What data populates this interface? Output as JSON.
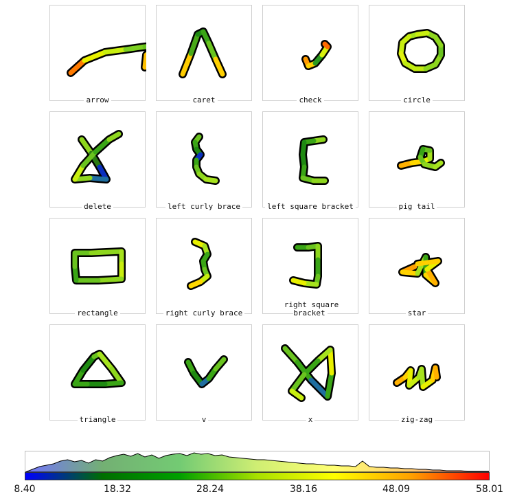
{
  "gestures": [
    {
      "label": "arrow",
      "colors": [
        "#ff7a00",
        "#ffb000",
        "#e8f000",
        "#c8ee10",
        "#9fe020",
        "#7ccf22",
        "#66c01e",
        "#9fe020",
        "#d6ef10",
        "#ffc000"
      ]
    },
    {
      "label": "caret",
      "colors": [
        "#ffcc00",
        "#c8ee10",
        "#4aaa18",
        "#1f8a12",
        "#139012",
        "#3aa516",
        "#6ac31f",
        "#a6e21e",
        "#ffd000"
      ]
    },
    {
      "label": "check",
      "colors": [
        "#ff9900",
        "#ffd200",
        "#2a3fcc",
        "#2a9a20",
        "#d8f010",
        "#ff6a00"
      ]
    },
    {
      "label": "circle",
      "colors": [
        "#a6e21e",
        "#c8ee10",
        "#e0f210",
        "#c0ea12",
        "#8ed61e",
        "#6ac31f",
        "#8ed61e",
        "#c8ee10"
      ]
    },
    {
      "label": "delete",
      "colors": [
        "#8ed61e",
        "#2a7a12",
        "#0a2fbf",
        "#1f6ea0",
        "#3aa516",
        "#8ed61e",
        "#c8ee10",
        "#6ac31f",
        "#3aa516",
        "#8ed61e"
      ]
    },
    {
      "label": "left curly brace",
      "colors": [
        "#6ac31f",
        "#3aa516",
        "#1f8a12",
        "#0a2fbf",
        "#1f8a12",
        "#3aa516",
        "#6ac31f",
        "#8ed61e",
        "#a6e21e"
      ]
    },
    {
      "label": "left square bracket",
      "colors": [
        "#8ed61e",
        "#3aa516",
        "#1f8a12",
        "#0a2fbf",
        "#1f8a12",
        "#3aa516",
        "#6ac31f",
        "#8ed61e"
      ]
    },
    {
      "label": "pig tail",
      "colors": [
        "#ffb000",
        "#ffd800",
        "#e8f000",
        "#a6e21e",
        "#6ac31f",
        "#3aa516",
        "#6ac31f",
        "#8ed61e",
        "#a6e21e"
      ]
    },
    {
      "label": "rectangle",
      "colors": [
        "#6ac31f",
        "#8ed61e",
        "#a6e21e",
        "#c8ee10",
        "#a6e21e",
        "#8ed61e",
        "#6ac31f",
        "#3aa516",
        "#6ac31f"
      ]
    },
    {
      "label": "right curly brace",
      "colors": [
        "#e8f000",
        "#a6e21e",
        "#3aa516",
        "#0a2fbf",
        "#3aa516",
        "#6ac31f",
        "#c8ee10",
        "#ffd800"
      ]
    },
    {
      "label": "right square bracket",
      "colors": [
        "#3aa516",
        "#6ac31f",
        "#8ed61e",
        "#3aa516",
        "#6ac31f",
        "#a6e21e",
        "#e8f000"
      ]
    },
    {
      "label": "star",
      "colors": [
        "#ffa000",
        "#ffd200",
        "#a6e21e",
        "#3aa516",
        "#c8ee10",
        "#ffd800",
        "#ffb000",
        "#e8f000",
        "#ffd000"
      ]
    },
    {
      "label": "triangle",
      "colors": [
        "#3aa516",
        "#1f8a12",
        "#6ac31f",
        "#a6e21e",
        "#8ed61e",
        "#3aa516",
        "#1f8a12",
        "#3aa516"
      ]
    },
    {
      "label": "v",
      "colors": [
        "#3aa516",
        "#1f8a12",
        "#0a2fbf",
        "#1f6ea0",
        "#3aa516",
        "#6ac31f"
      ]
    },
    {
      "label": "x",
      "colors": [
        "#6ac31f",
        "#3aa516",
        "#1f6ea0",
        "#3aa516",
        "#a6e21e",
        "#e8f000",
        "#a6e21e",
        "#3aa516",
        "#6ac31f",
        "#c8ee10"
      ]
    },
    {
      "label": "zig-zag",
      "colors": [
        "#ffb000",
        "#ffd200",
        "#e8f000",
        "#c8ee10",
        "#a6e21e",
        "#e8f000",
        "#ffd000",
        "#ffb000"
      ]
    }
  ],
  "legend": {
    "ticks": [
      "8.40",
      "18.32",
      "28.24",
      "38.16",
      "48.09",
      "58.01"
    ],
    "min": 8.4,
    "max": 58.01,
    "colormap": [
      "#0000ff",
      "#006f00",
      "#00a000",
      "#a8e000",
      "#ffff00",
      "#ffa000",
      "#ff0000"
    ]
  }
}
